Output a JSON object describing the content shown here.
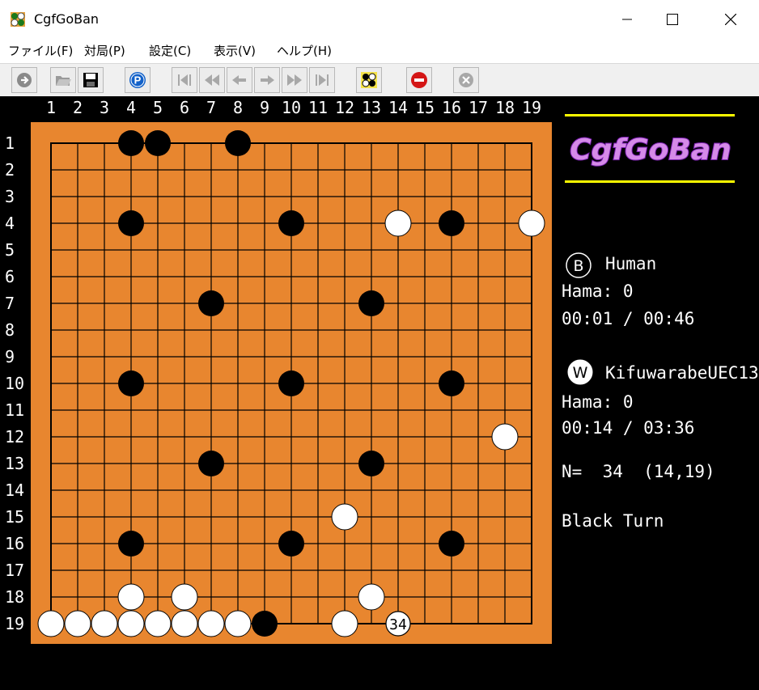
{
  "window": {
    "title": "CgfGoBan",
    "icon": "go-board-icon"
  },
  "menu": [
    {
      "label": "ファイル(F)"
    },
    {
      "label": "対局(P)"
    },
    {
      "label": "設定(C)"
    },
    {
      "label": "表示(V)"
    },
    {
      "label": "ヘルプ(H)"
    }
  ],
  "toolbar": [
    {
      "name": "new-game-icon",
      "enabled": true
    },
    {
      "name": "open-file-icon",
      "enabled": false
    },
    {
      "name": "save-icon",
      "enabled": true
    },
    {
      "name": "pass-icon",
      "enabled": true
    },
    {
      "name": "go-to-start-icon",
      "enabled": false
    },
    {
      "name": "back-ten-icon",
      "enabled": false
    },
    {
      "name": "back-one-icon",
      "enabled": false
    },
    {
      "name": "forward-one-icon",
      "enabled": false
    },
    {
      "name": "forward-ten-icon",
      "enabled": false
    },
    {
      "name": "go-to-end-icon",
      "enabled": false
    },
    {
      "name": "board-setup-icon",
      "enabled": true
    },
    {
      "name": "stop-icon",
      "enabled": true
    },
    {
      "name": "cancel-icon",
      "enabled": false
    }
  ],
  "board": {
    "size": 19,
    "col_labels": [
      "1",
      "2",
      "3",
      "4",
      "5",
      "6",
      "7",
      "8",
      "9",
      "10",
      "11",
      "12",
      "13",
      "14",
      "15",
      "16",
      "17",
      "18",
      "19"
    ],
    "row_labels": [
      "1",
      "2",
      "3",
      "4",
      "5",
      "6",
      "7",
      "8",
      "9",
      "10",
      "11",
      "12",
      "13",
      "14",
      "15",
      "16",
      "17",
      "18",
      "19"
    ],
    "colors": {
      "board": "#e8862f",
      "background": "#000000",
      "line": "#000000"
    },
    "black_stones": [
      [
        4,
        1
      ],
      [
        5,
        1
      ],
      [
        8,
        1
      ],
      [
        4,
        4
      ],
      [
        10,
        4
      ],
      [
        16,
        4
      ],
      [
        7,
        7
      ],
      [
        13,
        7
      ],
      [
        4,
        10
      ],
      [
        10,
        10
      ],
      [
        16,
        10
      ],
      [
        7,
        13
      ],
      [
        13,
        13
      ],
      [
        4,
        16
      ],
      [
        10,
        16
      ],
      [
        16,
        16
      ],
      [
        9,
        19
      ]
    ],
    "white_stones": [
      [
        14,
        4
      ],
      [
        19,
        4
      ],
      [
        18,
        12
      ],
      [
        12,
        15
      ],
      [
        4,
        18
      ],
      [
        6,
        18
      ],
      [
        13,
        18
      ],
      [
        1,
        19
      ],
      [
        2,
        19
      ],
      [
        3,
        19
      ],
      [
        4,
        19
      ],
      [
        5,
        19
      ],
      [
        6,
        19
      ],
      [
        7,
        19
      ],
      [
        8,
        19
      ],
      [
        12,
        19
      ]
    ],
    "last_move": {
      "x": 14,
      "y": 19,
      "number": "34",
      "color": "white"
    }
  },
  "side": {
    "logo": "CgfGoBan",
    "black": {
      "marker": "B",
      "name": "Human",
      "hama": "Hama: 0",
      "time": "00:01 / 00:46"
    },
    "white": {
      "marker": "W",
      "name": "KifuwarabeUEC13",
      "hama": "Hama: 0",
      "time": "00:14 / 03:36"
    },
    "move_info": "N=  34  (14,19)",
    "turn": "Black Turn"
  }
}
